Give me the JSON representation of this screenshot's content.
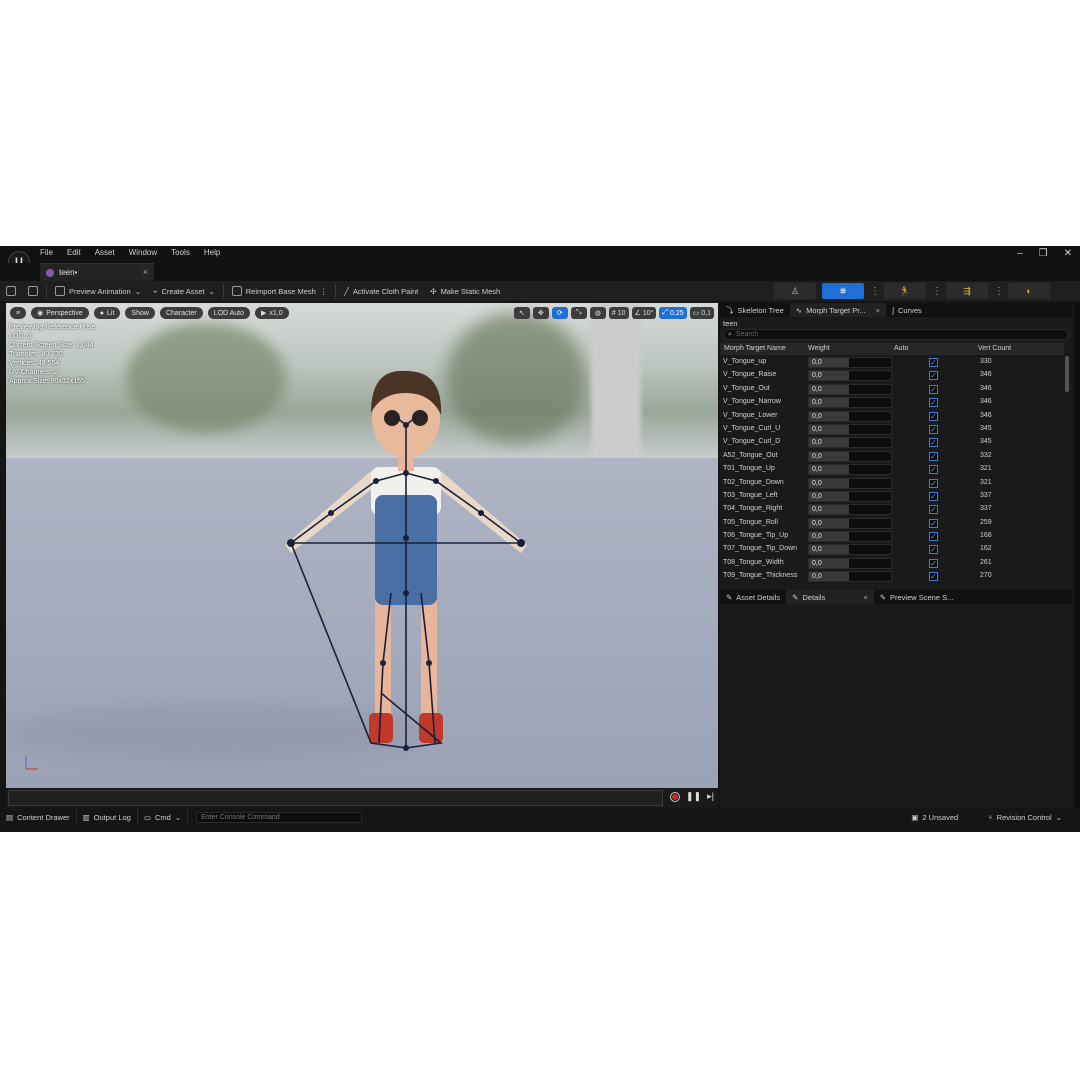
{
  "app": {
    "logo": "U",
    "menu": [
      "File",
      "Edit",
      "Asset",
      "Window",
      "Tools",
      "Help"
    ],
    "window_controls": [
      "–",
      "❐",
      "✕"
    ],
    "document_tab": {
      "label": "teen•",
      "close": "×"
    }
  },
  "toolbar": {
    "preview_animation": "Preview Animation",
    "create_asset": "Create Asset",
    "reimport_base_mesh": "Reimport Base Mesh",
    "activate_cloth_paint": "Activate Cloth Paint",
    "make_static_mesh": "Make Static Mesh"
  },
  "viewport": {
    "perspective": "Perspective",
    "lit": "Lit",
    "show": "Show",
    "character": "Character",
    "lod": "LOD Auto",
    "play_rate": "x1,0",
    "grid_size": "10",
    "rotation_snap": "10°",
    "scale_snap": "0,25",
    "camera_speed": "0,1",
    "stats": [
      "Previewing Reference Pose",
      "LOD: 0",
      "Current Screen Size: 1,044",
      "Triangles: 80 730",
      "Vertices: 48 554",
      "UV Channels: 2",
      "Approx Size: 90x32x155"
    ]
  },
  "right_panel": {
    "tabs": [
      {
        "label": "Skeleton Tree"
      },
      {
        "label": "Morph Target Pr...",
        "close": "×"
      },
      {
        "label": "Curves"
      }
    ],
    "mesh_name": "teen",
    "search_placeholder": "Search",
    "columns": {
      "name": "Morph Target Name",
      "weight": "Weight",
      "auto": "Auto",
      "vert_count": "Vert Count"
    },
    "morph_targets": [
      {
        "name": "V_Tongue_up",
        "weight": "0,0",
        "auto": true,
        "vert_count": "330"
      },
      {
        "name": "V_Tongue_Raise",
        "weight": "0,0",
        "auto": true,
        "vert_count": "346"
      },
      {
        "name": "V_Tongue_Out",
        "weight": "0,0",
        "auto": true,
        "vert_count": "346"
      },
      {
        "name": "V_Tongue_Narrow",
        "weight": "0,0",
        "auto": true,
        "vert_count": "346"
      },
      {
        "name": "V_Tongue_Lower",
        "weight": "0,0",
        "auto": true,
        "vert_count": "346"
      },
      {
        "name": "V_Tongue_Curl_U",
        "weight": "0,0",
        "auto": true,
        "vert_count": "345"
      },
      {
        "name": "V_Tongue_Curl_D",
        "weight": "0,0",
        "auto": true,
        "vert_count": "345"
      },
      {
        "name": "A52_Tongue_Out",
        "weight": "0,0",
        "auto": true,
        "vert_count": "332"
      },
      {
        "name": "T01_Tongue_Up",
        "weight": "0,0",
        "auto": true,
        "vert_count": "321"
      },
      {
        "name": "T02_Tongue_Down",
        "weight": "0,0",
        "auto": true,
        "vert_count": "321"
      },
      {
        "name": "T03_Tongue_Left",
        "weight": "0,0",
        "auto": true,
        "vert_count": "337"
      },
      {
        "name": "T04_Tongue_Right",
        "weight": "0,0",
        "auto": true,
        "vert_count": "337"
      },
      {
        "name": "T05_Tongue_Roll",
        "weight": "0,0",
        "auto": true,
        "vert_count": "259"
      },
      {
        "name": "T06_Tongue_Tip_Up",
        "weight": "0,0",
        "auto": true,
        "vert_count": "168"
      },
      {
        "name": "T07_Tongue_Tip_Down",
        "weight": "0,0",
        "auto": true,
        "vert_count": "162"
      },
      {
        "name": "T08_Tongue_Width",
        "weight": "0,0",
        "auto": true,
        "vert_count": "261"
      },
      {
        "name": "T09_Tongue_Thickness",
        "weight": "0,0",
        "auto": true,
        "vert_count": "270"
      }
    ],
    "detail_tabs": [
      {
        "label": "Asset Details"
      },
      {
        "label": "Details",
        "close": "×"
      },
      {
        "label": "Preview Scene S..."
      }
    ]
  },
  "status_bar": {
    "content_drawer": "Content Drawer",
    "output_log": "Output Log",
    "cmd": "Cmd",
    "console_placeholder": "Enter Console Command",
    "unsaved": "2 Unsaved",
    "revision_control": "Revision Control"
  },
  "colors": {
    "accent": "#1e6fd6",
    "panel": "#1a1a1a",
    "background": "#151515"
  }
}
